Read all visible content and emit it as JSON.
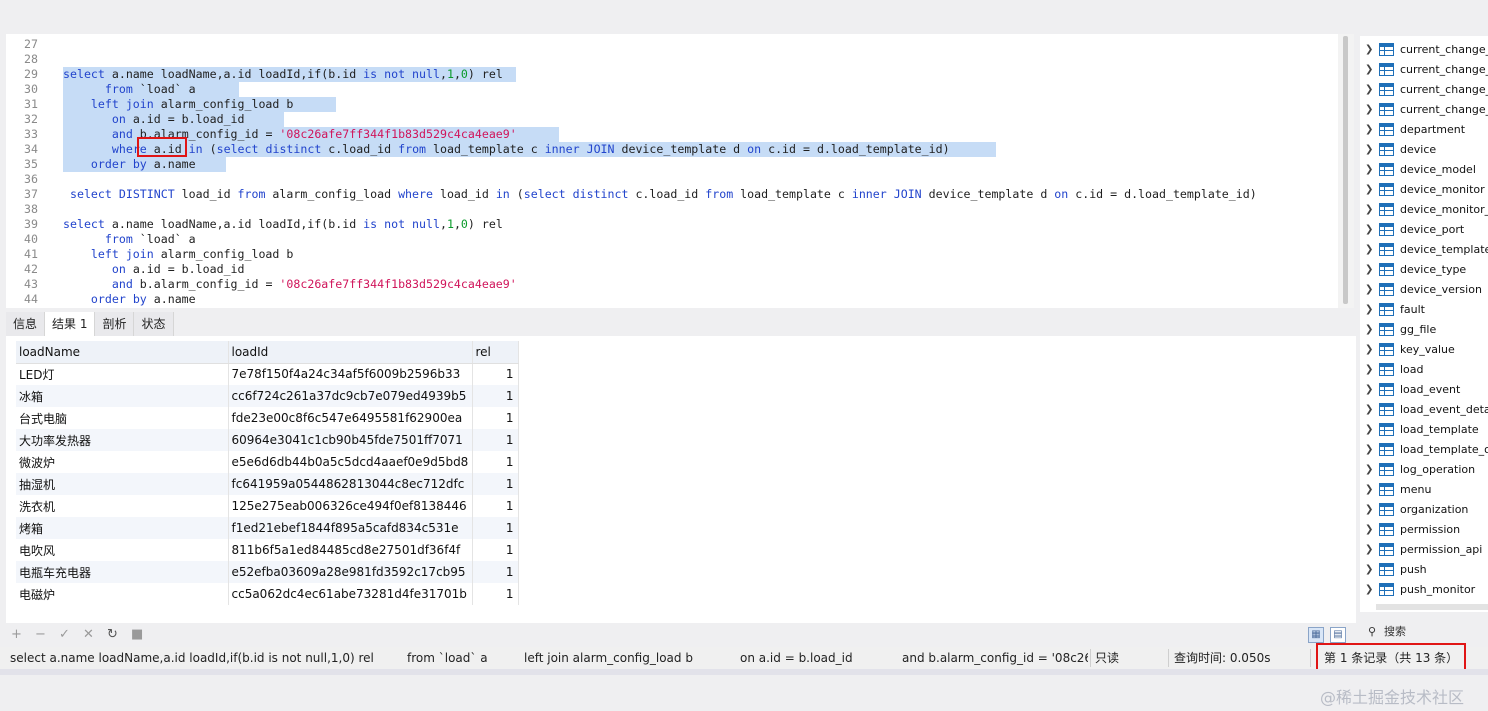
{
  "editor": {
    "lines": [
      {
        "n": "27",
        "t": ""
      },
      {
        "n": "28",
        "t": ""
      },
      {
        "n": "29",
        "t": "select a.name loadName,a.id loadId,if(b.id is not null,1,0) rel"
      },
      {
        "n": "30",
        "t": "      from `load` a"
      },
      {
        "n": "31",
        "t": "    left join alarm_config_load b"
      },
      {
        "n": "32",
        "t": "       on a.id = b.load_id"
      },
      {
        "n": "33",
        "t": "       and b.alarm_config_id = '08c26afe7ff344f1b83d529c4ca4eae9'"
      },
      {
        "n": "34",
        "t": "       where a.id in (select distinct c.load_id from load_template c inner JOIN device_template d on c.id = d.load_template_id)"
      },
      {
        "n": "35",
        "t": "    order by a.name"
      },
      {
        "n": "36",
        "t": ""
      },
      {
        "n": "37",
        "t": " select DISTINCT load_id from alarm_config_load where load_id in (select distinct c.load_id from load_template c inner JOIN device_template d on c.id = d.load_template_id)"
      },
      {
        "n": "38",
        "t": ""
      },
      {
        "n": "39",
        "t": "select a.name loadName,a.id loadId,if(b.id is not null,1,0) rel"
      },
      {
        "n": "40",
        "t": "      from `load` a"
      },
      {
        "n": "41",
        "t": "    left join alarm_config_load b"
      },
      {
        "n": "42",
        "t": "       on a.id = b.load_id"
      },
      {
        "n": "43",
        "t": "       and b.alarm_config_id = '08c26afe7ff344f1b83d529c4ca4eae9'"
      },
      {
        "n": "44",
        "t": "    order by a.name"
      }
    ]
  },
  "tabs": [
    {
      "label": "信息",
      "active": false
    },
    {
      "label": "结果 1",
      "active": true
    },
    {
      "label": "剖析",
      "active": false
    },
    {
      "label": "状态",
      "active": false
    }
  ],
  "grid": {
    "columns": [
      "loadName",
      "loadId",
      "rel"
    ],
    "rows": [
      [
        "LED灯",
        "7e78f150f4a24c34af5f6009b2596b33",
        "1"
      ],
      [
        "冰箱",
        "cc6f724c261a37dc9cb7e079ed4939b5",
        "1"
      ],
      [
        "台式电脑",
        "fde23e00c8f6c547e6495581f62900ea",
        "1"
      ],
      [
        "大功率发热器",
        "60964e3041c1cb90b45fde7501ff7071",
        "1"
      ],
      [
        "微波炉",
        "e5e6d6db44b0a5c5dcd4aaef0e9d5bd8",
        "1"
      ],
      [
        "抽湿机",
        "fc641959a0544862813044c8ec712dfc",
        "1"
      ],
      [
        "洗衣机",
        "125e275eab006326ce494f0ef8138446",
        "1"
      ],
      [
        "烤箱",
        "f1ed21ebef1844f895a5cafd834c531e",
        "1"
      ],
      [
        "电吹风",
        "811b6f5a1ed84485cd8e27501df36f4f",
        "1"
      ],
      [
        "电瓶车充电器",
        "e52efba03609a28e981fd3592c17cb95",
        "1"
      ],
      [
        "电磁炉",
        "cc5a062dc4ec61abe73281d4fe31701b",
        "1"
      ]
    ]
  },
  "toolbar": {
    "icons": [
      "plus-icon",
      "minus-icon",
      "check-icon",
      "cross-icon",
      "refresh-icon",
      "stop-icon"
    ],
    "glyphs": [
      "+",
      "−",
      "✓",
      "✕",
      "↻",
      "■"
    ]
  },
  "statusbar": {
    "sql_parts": [
      "select a.name loadName,a.id loadId,if(b.id is not null,1,0) rel",
      "from `load` a",
      "left join alarm_config_load b",
      "on a.id = b.load_id",
      "and b.alarm_config_id = '08c26a"
    ],
    "readonly": "只读",
    "query_time": "查询时间: 0.050s",
    "record_info": "第 1 条记录（共 13 条）"
  },
  "tree": {
    "items": [
      "current_change_a",
      "current_change_d",
      "current_change_s",
      "current_change_u",
      "department",
      "device",
      "device_model",
      "device_monitor",
      "device_monitor_de",
      "device_port",
      "device_template",
      "device_type",
      "device_version",
      "fault",
      "gg_file",
      "key_value",
      "load",
      "load_event",
      "load_event_detail",
      "load_template",
      "load_template_old",
      "log_operation",
      "menu",
      "organization",
      "permission",
      "permission_api",
      "push",
      "push_monitor"
    ]
  },
  "search": {
    "label": "搜索"
  },
  "watermark": "@稀土掘金技术社区",
  "colors": {
    "highlight_box": "#e01515",
    "selection": "#c6dcf6",
    "keyword": "#2244cc",
    "string": "#d0145a",
    "number": "#0a9a2a"
  }
}
